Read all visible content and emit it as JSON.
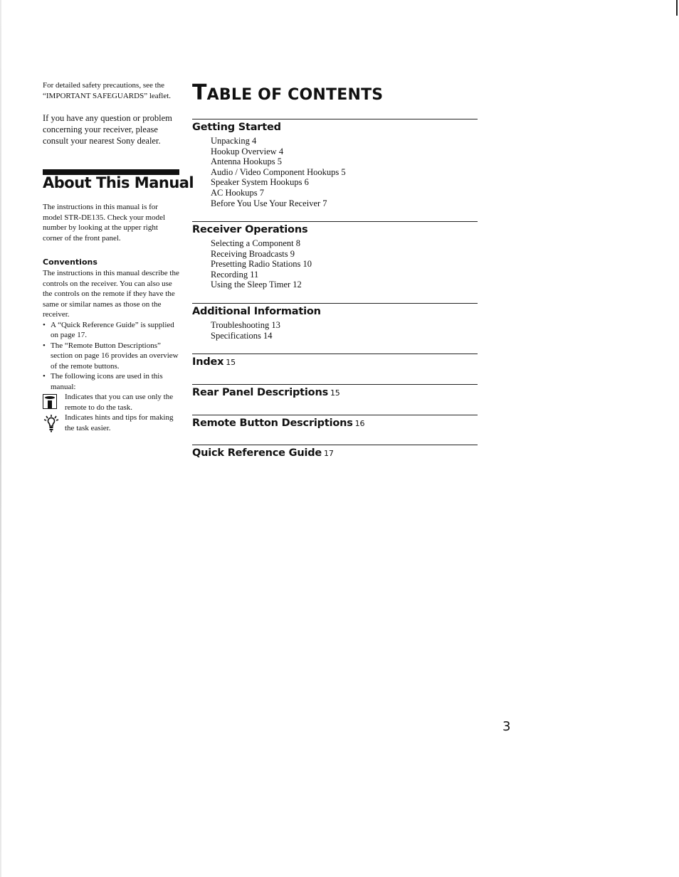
{
  "left_column": {
    "safety_note": "For detailed safety precautions, see the “IMPORTANT SAFEGUARDS” leaflet.",
    "contact_note": "If you have any question or problem concerning your receiver, please consult your nearest Sony dealer.",
    "about_title": "About This Manual",
    "about_body": "The instructions in this manual is for model STR-DE135. Check your model number by looking at the upper right corner of the front panel.",
    "conventions": {
      "title": "Conventions",
      "body": "The instructions in this manual describe the controls on the receiver. You can also use the controls on the remote if they have the same or similar names as those on the receiver.",
      "bullets": [
        "A “Quick Reference Guide” is supplied on page 17.",
        "The “Remote Button Descriptions” section on page 16 provides an overview of the remote buttons.",
        "The following icons are used in this manual:"
      ],
      "icons": [
        {
          "icon": "remote-icon",
          "text": "Indicates that you can use only the remote to do the task."
        },
        {
          "icon": "lightbulb-icon",
          "text": "Indicates hints and tips for making the task easier."
        }
      ]
    }
  },
  "toc": {
    "title_first_letter": "T",
    "title_rest": "ABLE OF CONTENTS",
    "sections": [
      {
        "heading": "Getting Started",
        "items": [
          {
            "label": "Unpacking",
            "page": "4"
          },
          {
            "label": "Hookup Overview",
            "page": "4"
          },
          {
            "label": "Antenna Hookups",
            "page": "5"
          },
          {
            "label": "Audio / Video Component Hookups",
            "page": "5"
          },
          {
            "label": "Speaker System Hookups",
            "page": "6"
          },
          {
            "label": "AC Hookups",
            "page": "7"
          },
          {
            "label": "Before You Use Your Receiver",
            "page": "7"
          }
        ]
      },
      {
        "heading": "Receiver Operations",
        "items": [
          {
            "label": "Selecting a Component",
            "page": "8"
          },
          {
            "label": "Receiving Broadcasts",
            "page": "9"
          },
          {
            "label": "Presetting Radio Stations",
            "page": "10"
          },
          {
            "label": "Recording",
            "page": "11"
          },
          {
            "label": "Using the Sleep Timer",
            "page": "12"
          }
        ]
      },
      {
        "heading": "Additional Information",
        "items": [
          {
            "label": "Troubleshooting",
            "page": "13"
          },
          {
            "label": "Specifications",
            "page": "14"
          }
        ]
      },
      {
        "heading": "Index",
        "page": "15"
      },
      {
        "heading": "Rear Panel Descriptions",
        "page": "15"
      },
      {
        "heading": "Remote Button Descriptions",
        "page": "16"
      },
      {
        "heading": "Quick Reference Guide",
        "page": "17"
      }
    ]
  },
  "page_number": "3"
}
